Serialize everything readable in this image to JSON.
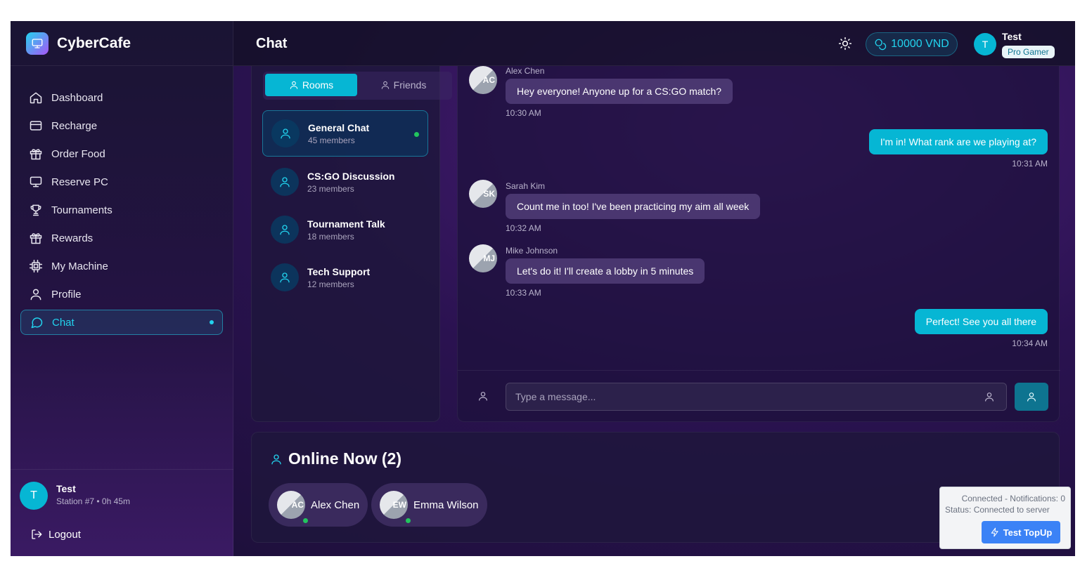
{
  "brand": {
    "name": "CyberCafe",
    "logo_icon": "monitor-icon"
  },
  "sidebar": {
    "items": [
      {
        "label": "Dashboard",
        "icon": "home-icon"
      },
      {
        "label": "Recharge",
        "icon": "card-icon"
      },
      {
        "label": "Order Food",
        "icon": "gift-icon"
      },
      {
        "label": "Reserve PC",
        "icon": "monitor-icon"
      },
      {
        "label": "Tournaments",
        "icon": "trophy-icon"
      },
      {
        "label": "Rewards",
        "icon": "gift-icon"
      },
      {
        "label": "My Machine",
        "icon": "cpu-icon"
      },
      {
        "label": "Profile",
        "icon": "user-icon"
      },
      {
        "label": "Chat",
        "icon": "chat-icon",
        "active": true
      }
    ],
    "user": {
      "initial": "T",
      "name": "Test",
      "station": "Station #7 • 0h 45m"
    },
    "logout_label": "Logout"
  },
  "header": {
    "title": "Chat",
    "balance": "10000 VND",
    "user": {
      "initial": "T",
      "name": "Test",
      "badge": "Pro Gamer"
    }
  },
  "rooms_panel": {
    "tabs": [
      {
        "label": "Rooms",
        "active": true
      },
      {
        "label": "Friends",
        "active": false
      }
    ],
    "rooms": [
      {
        "name": "General Chat",
        "members": "45 members",
        "active": true
      },
      {
        "name": "CS:GO Discussion",
        "members": "23 members",
        "active": false
      },
      {
        "name": "Tournament Talk",
        "members": "18 members",
        "active": false
      },
      {
        "name": "Tech Support",
        "members": "12 members",
        "active": false
      }
    ]
  },
  "messages": [
    {
      "incoming": true,
      "sender": "Alex Chen",
      "initials": "AC",
      "text": "Hey everyone! Anyone up for a CS:GO match?",
      "time": "10:30 AM"
    },
    {
      "incoming": false,
      "text": "I'm in! What rank are we playing at?",
      "time": "10:31 AM"
    },
    {
      "incoming": true,
      "sender": "Sarah Kim",
      "initials": "SK",
      "text": "Count me in too! I've been practicing my aim all week",
      "time": "10:32 AM"
    },
    {
      "incoming": true,
      "sender": "Mike Johnson",
      "initials": "MJ",
      "text": "Let's do it! I'll create a lobby in 5 minutes",
      "time": "10:33 AM"
    },
    {
      "incoming": false,
      "text": "Perfect! See you all there",
      "time": "10:34 AM"
    }
  ],
  "composer": {
    "placeholder": "Type a message..."
  },
  "online": {
    "title": "Online Now (2)",
    "users": [
      {
        "initials": "AC",
        "name": "Alex Chen"
      },
      {
        "initials": "EW",
        "name": "Emma Wilson"
      }
    ]
  },
  "debug": {
    "line1": "Connected - Notifications: 0",
    "line2": "Status: Connected to server",
    "button": "Test TopUp"
  },
  "colors": {
    "accent": "#06b6d4",
    "online": "#22c55e",
    "topup": "#3b82f6"
  }
}
